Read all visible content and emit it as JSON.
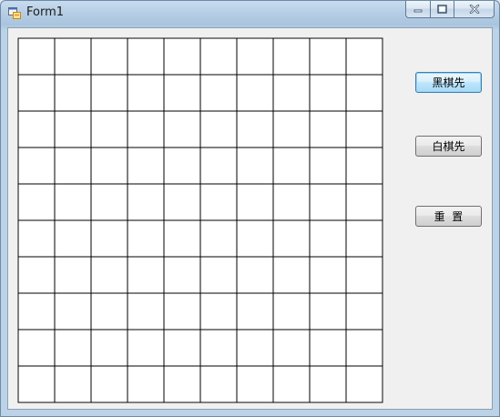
{
  "window": {
    "title": "Form1",
    "controls": {
      "minimize": "minimize-icon",
      "maximize": "restore-icon",
      "close": "close-icon"
    }
  },
  "board": {
    "rows": 10,
    "cols": 10,
    "line_color": "#000000",
    "background": "#ffffff"
  },
  "buttons": {
    "black_first": "黑棋先",
    "white_first": "白棋先",
    "reset": "重  置"
  }
}
